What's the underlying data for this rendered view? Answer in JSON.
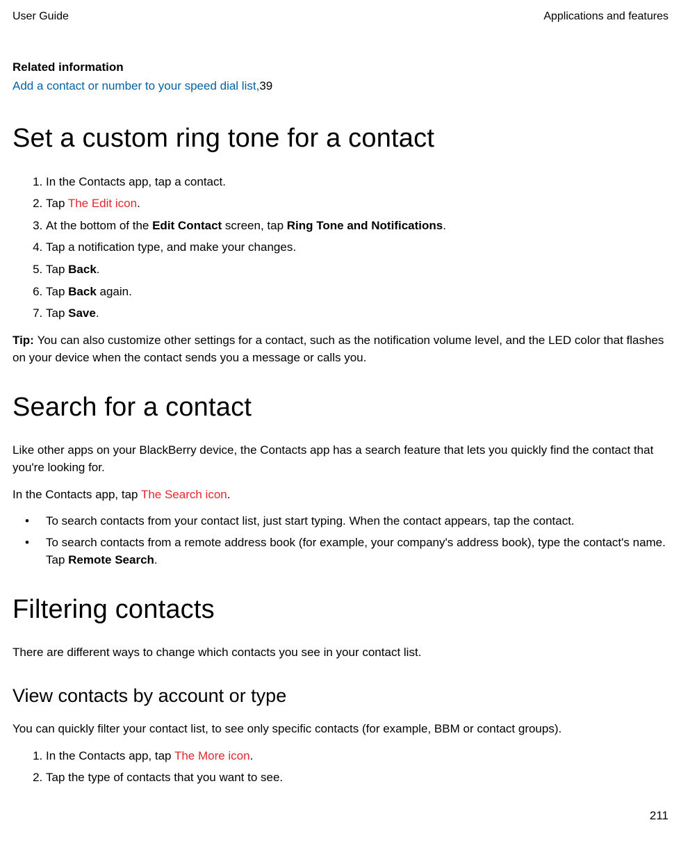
{
  "header": {
    "left": "User Guide",
    "right": "Applications and features"
  },
  "related": {
    "heading": "Related information",
    "linkText": "Add a contact or number to your speed dial list,",
    "linkPage": "39"
  },
  "section1": {
    "title": "Set a custom ring tone for a contact",
    "steps": {
      "s1": "In the Contacts app, tap a contact.",
      "s2a": "Tap ",
      "s2icon": "The Edit icon",
      "s2b": ".",
      "s3a": "At the bottom of the ",
      "s3b1": "Edit Contact",
      "s3c": " screen, tap ",
      "s3b2": "Ring Tone and Notifications",
      "s3d": ".",
      "s4": "Tap a notification type, and make your changes.",
      "s5a": "Tap ",
      "s5b": "Back",
      "s5c": ".",
      "s6a": "Tap ",
      "s6b": "Back",
      "s6c": " again.",
      "s7a": "Tap ",
      "s7b": "Save",
      "s7c": "."
    },
    "tipLabel": "Tip: ",
    "tipText": "You can also customize other settings for a contact, such as the notification volume level, and the LED color that flashes on your device when the contact sends you a message or calls you."
  },
  "section2": {
    "title": "Search for a contact",
    "intro": "Like other apps on your BlackBerry device, the Contacts app has a search feature that lets you quickly find the contact that you're looking for.",
    "line2a": "In the Contacts app, tap ",
    "line2icon": "The Search icon",
    "line2b": ".",
    "b1": "To search contacts from your contact list, just start typing. When the contact appears, tap the contact.",
    "b2a": "To search contacts from a remote address book (for example, your company's address book), type the contact's name. Tap ",
    "b2b": "Remote Search",
    "b2c": "."
  },
  "section3": {
    "title": "Filtering contacts",
    "intro": "There are different ways to change which contacts you see in your contact list.",
    "subTitle": "View contacts by account or type",
    "subIntro": "You can quickly filter your contact list, to see only specific contacts (for example, BBM or contact groups).",
    "s1a": "In the Contacts app, tap ",
    "s1icon": "The More icon",
    "s1b": ".",
    "s2": "Tap the type of contacts that you want to see."
  },
  "pageNumber": "211"
}
